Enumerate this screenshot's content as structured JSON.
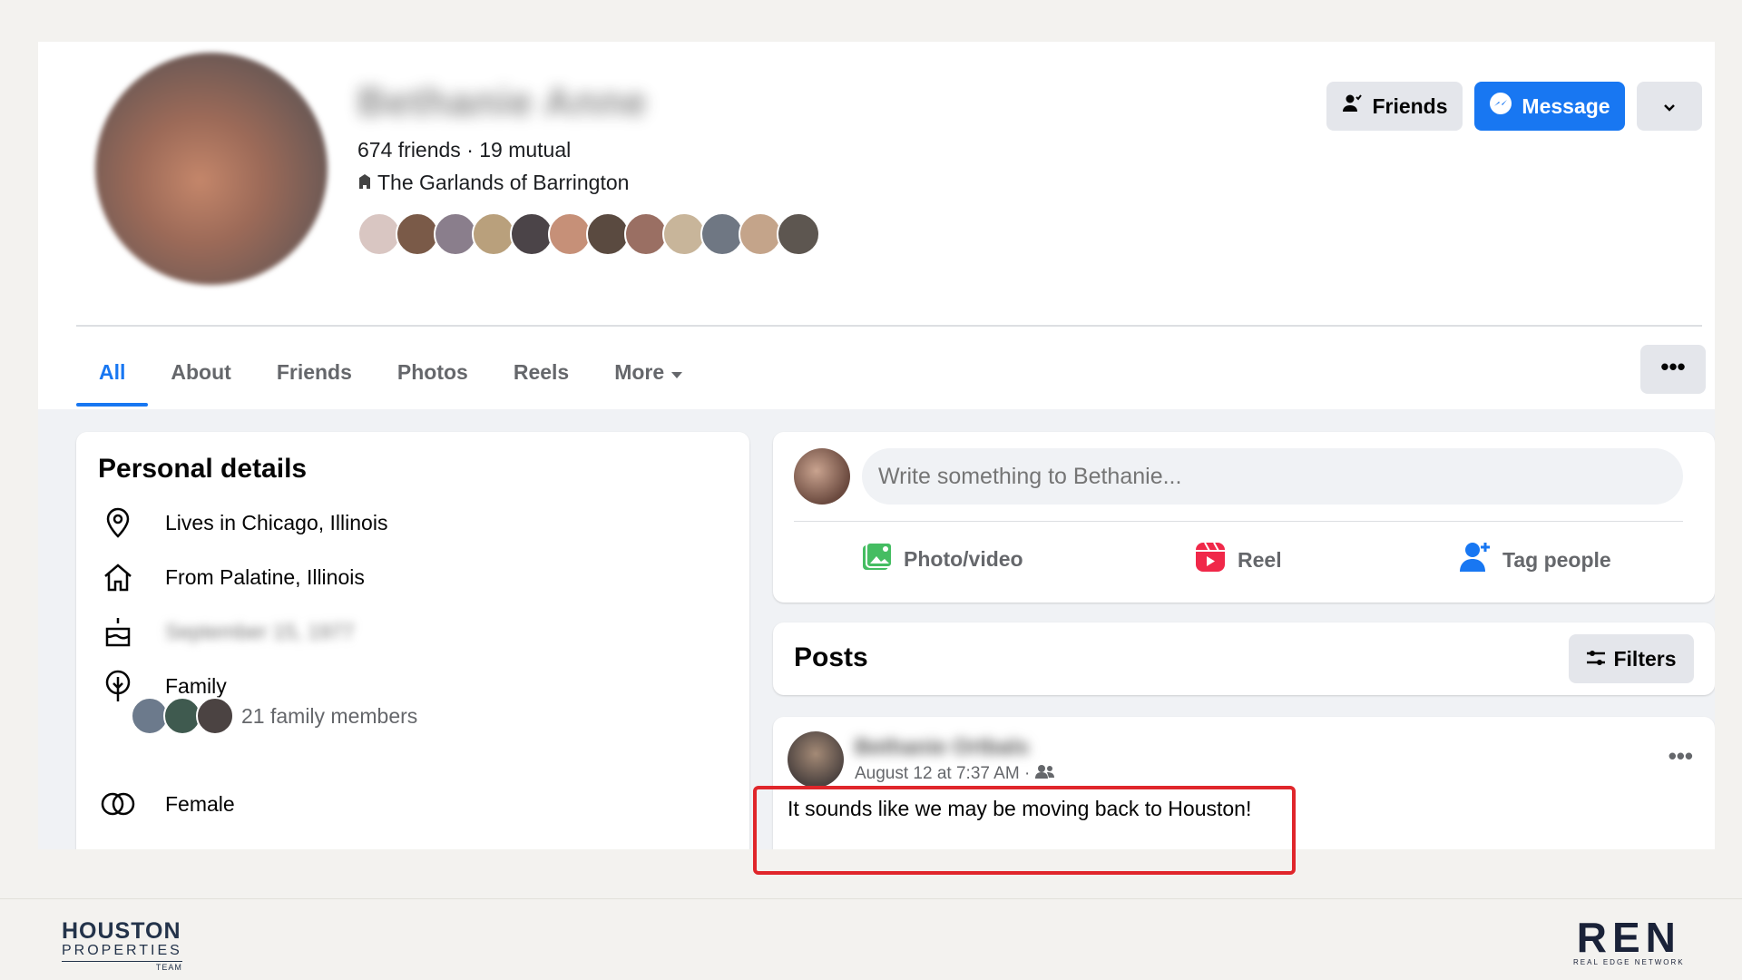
{
  "profile": {
    "name": "Bethanie Anne",
    "counts": "674 friends · 19 mutual",
    "location": "The Garlands of Barrington",
    "friend_avatar_colors": [
      "#d9c6c2",
      "#7a5a48",
      "#8a7e8c",
      "#b9a07c",
      "#4b4448",
      "#c69078",
      "#5a4a40",
      "#9a6f63",
      "#c8b59a",
      "#6f7783",
      "#c4a48a",
      "#5d5650"
    ]
  },
  "actions": {
    "friends_label": "Friends",
    "message_label": "Message"
  },
  "tabs": [
    {
      "label": "All"
    },
    {
      "label": "About"
    },
    {
      "label": "Friends"
    },
    {
      "label": "Photos"
    },
    {
      "label": "Reels"
    },
    {
      "label": "More"
    }
  ],
  "details": {
    "title": "Personal details",
    "lives": "Lives in Chicago, Illinois",
    "from": "From Palatine, Illinois",
    "birthday": "September 15, 1977",
    "family_label": "Family",
    "family_members": "21 family members",
    "gender": "Female"
  },
  "composer": {
    "placeholder": "Write something to Bethanie...",
    "photo_video": "Photo/video",
    "reel": "Reel",
    "tag_people": "Tag people"
  },
  "posts": {
    "title": "Posts",
    "filters_label": "Filters"
  },
  "post": {
    "author": "Bethanie Ortbals",
    "time": "August 12 at 7:37 AM ·",
    "text": "It sounds like we may be moving back to Houston!"
  },
  "branding": {
    "left_line1": "HOUSTON",
    "left_line2": "PROPERTIES",
    "left_line3": "TEAM",
    "right_line1": "REN",
    "right_line2": "REAL EDGE NETWORK"
  },
  "colors": {
    "accent": "#1877f2",
    "highlight": "#e0262b"
  }
}
